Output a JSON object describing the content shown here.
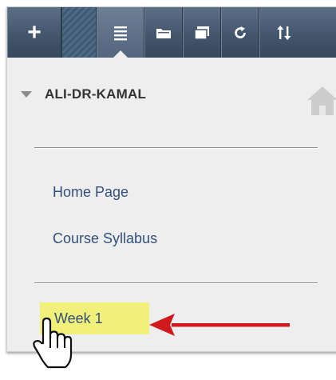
{
  "toolbar": {
    "buttons": [
      {
        "icon": "plus-icon",
        "glyph": "+"
      },
      {
        "icon": "hatched-segment"
      },
      {
        "icon": "list-icon",
        "active": true
      },
      {
        "icon": "folder-icon"
      },
      {
        "icon": "window-icon"
      },
      {
        "icon": "refresh-icon"
      },
      {
        "icon": "sort-icon"
      }
    ]
  },
  "course_menu": {
    "course_title": "ALI-DR-KAMAL",
    "links": [
      {
        "label": "Home Page"
      },
      {
        "label": "Course Syllabus"
      }
    ],
    "highlighted_link": {
      "label": "Week 1",
      "highlight_color": "#f1f07a"
    }
  },
  "colors": {
    "toolbar": "#43566d",
    "link": "#33507a",
    "panel": "#eeeeee",
    "annotation_arrow": "#d0191d"
  }
}
